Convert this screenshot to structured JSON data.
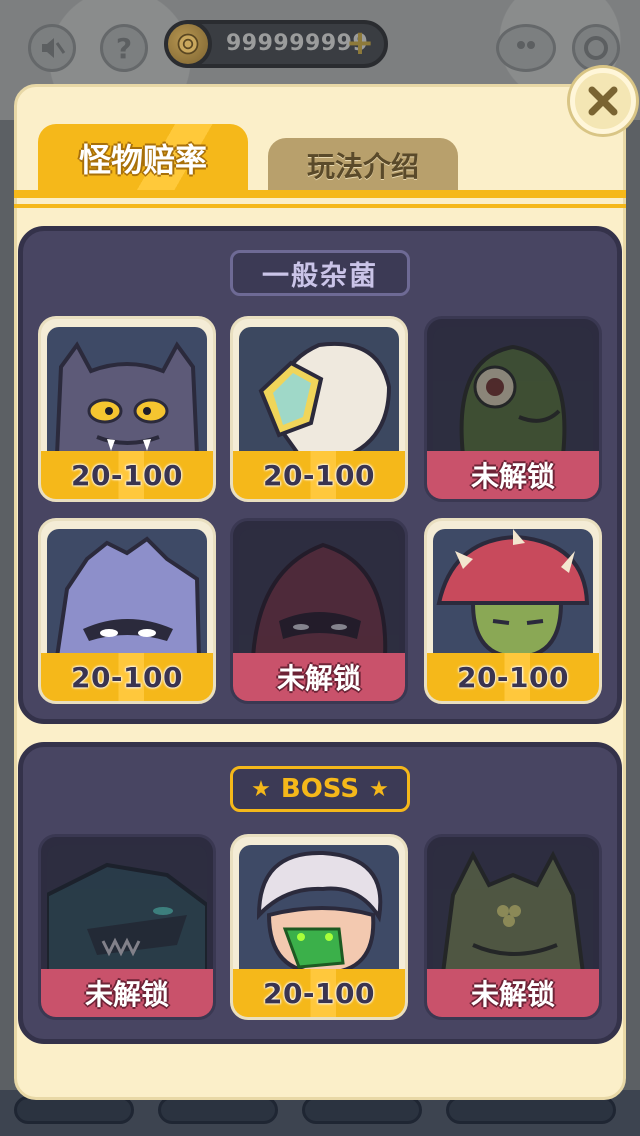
{
  "hud": {
    "coins": "999999999",
    "plus": "+",
    "help": "?"
  },
  "tabs": [
    {
      "label": "怪物赔率",
      "active": true
    },
    {
      "label": "玩法介绍",
      "active": false
    }
  ],
  "sections": {
    "normal": {
      "title": "一般杂菌",
      "cards": [
        {
          "monster": "gray-horned-beast",
          "label": "20-100",
          "locked": false
        },
        {
          "monster": "white-crystal-shell",
          "label": "20-100",
          "locked": false
        },
        {
          "monster": "green-cyclops",
          "label": "未解锁",
          "locked": true
        },
        {
          "monster": "lavender-masked-hedgehog",
          "label": "20-100",
          "locked": false
        },
        {
          "monster": "hooded-maroon-ninja",
          "label": "未解锁",
          "locked": true
        },
        {
          "monster": "spiked-mushroom-zombie",
          "label": "20-100",
          "locked": false
        }
      ]
    },
    "boss": {
      "title": "BOSS",
      "cards": [
        {
          "monster": "dark-shark-dragon",
          "label": "未解锁",
          "locked": true
        },
        {
          "monster": "white-haired-cyborg-boy",
          "label": "20-100",
          "locked": false
        },
        {
          "monster": "green-horned-lizard",
          "label": "未解锁",
          "locked": true
        }
      ]
    }
  },
  "colors": {
    "accent": "#f5b81a",
    "locked": "#c9526b",
    "section_bg": "#484562",
    "panel_bg": "#fbefc9"
  }
}
